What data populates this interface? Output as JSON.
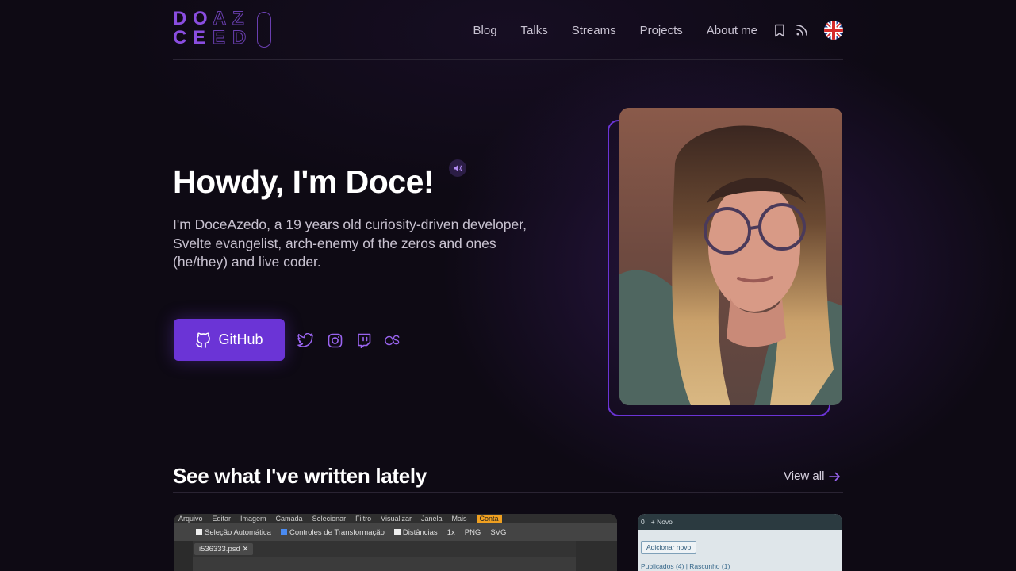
{
  "header": {
    "logo": {
      "row1": [
        "D",
        "O",
        "A",
        "Z"
      ],
      "row2": [
        "C",
        "E",
        "E",
        "D"
      ]
    },
    "nav": [
      "Blog",
      "Talks",
      "Streams",
      "Projects",
      "About me"
    ],
    "icons": [
      "bookmark-icon",
      "rss-icon",
      "uk-flag-icon"
    ]
  },
  "hero": {
    "title": "Howdy, I'm Doce!",
    "bio": "I'm DoceAzedo, a 19 years old curiosity-driven developer, Svelte evangelist, arch-enemy of the zeros and ones (he/they) and live coder.",
    "github_label": "GitHub",
    "socials": [
      "twitter-icon",
      "instagram-icon",
      "twitch-icon",
      "lastfm-icon"
    ]
  },
  "section": {
    "title": "See what I've written lately",
    "view_all": "View all"
  },
  "card1": {
    "menu": [
      "Arquivo",
      "Editar",
      "Imagem",
      "Camada",
      "Selecionar",
      "Filtro",
      "Visualizar",
      "Janela",
      "Mais",
      "Conta"
    ],
    "tool_auto": "Seleção Automática",
    "tool_transform": "Controles de Transformação",
    "tool_dist": "Distâncias",
    "zoom": "1x",
    "png": "PNG",
    "svg": "SVG",
    "tab": "i536333.psd"
  },
  "card2": {
    "count": "0",
    "new": "Novo",
    "add_button": "Adicionar novo",
    "links": "Publicados (4) | Rascunho (1)"
  },
  "colors": {
    "accent": "#6b34d6",
    "background": "#0e0a14"
  }
}
